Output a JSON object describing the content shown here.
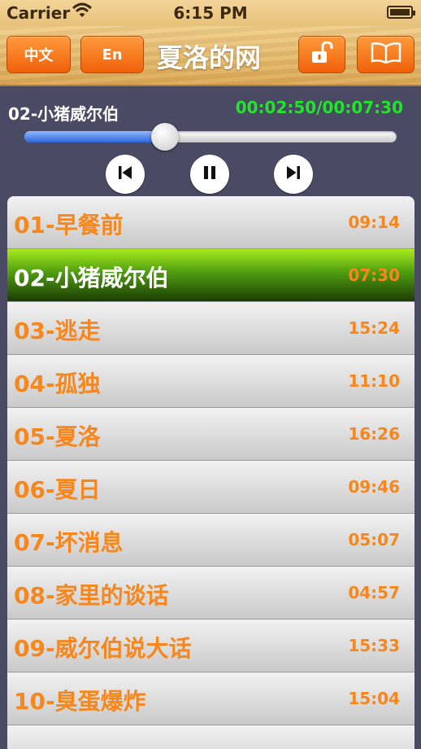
{
  "status_bar": {
    "carrier": "Carrier",
    "time": "6:15 PM"
  },
  "nav": {
    "btn_chinese": "中文",
    "btn_english": "En",
    "title": "夏洛的网"
  },
  "player": {
    "current_track": "02-小猪威尔伯",
    "time_readout": "00:02:50/00:07:30",
    "progress": 0.378
  },
  "colors": {
    "accent": "#f7871c",
    "time_green": "#22e42a",
    "active_row": "#4e9c10"
  },
  "tracks": [
    {
      "name": "01-早餐前",
      "duration": "09:14"
    },
    {
      "name": "02-小猪威尔伯",
      "duration": "07:30"
    },
    {
      "name": "03-逃走",
      "duration": "15:24"
    },
    {
      "name": "04-孤独",
      "duration": "11:10"
    },
    {
      "name": "05-夏洛",
      "duration": "16:26"
    },
    {
      "name": "06-夏日",
      "duration": "09:46"
    },
    {
      "name": "07-坏消息",
      "duration": "05:07"
    },
    {
      "name": "08-家里的谈话",
      "duration": "04:57"
    },
    {
      "name": "09-威尔伯说大话",
      "duration": "15:33"
    },
    {
      "name": "10-臭蛋爆炸",
      "duration": "15:04"
    },
    {
      "name": "",
      "duration": ""
    }
  ],
  "active_index": 1
}
